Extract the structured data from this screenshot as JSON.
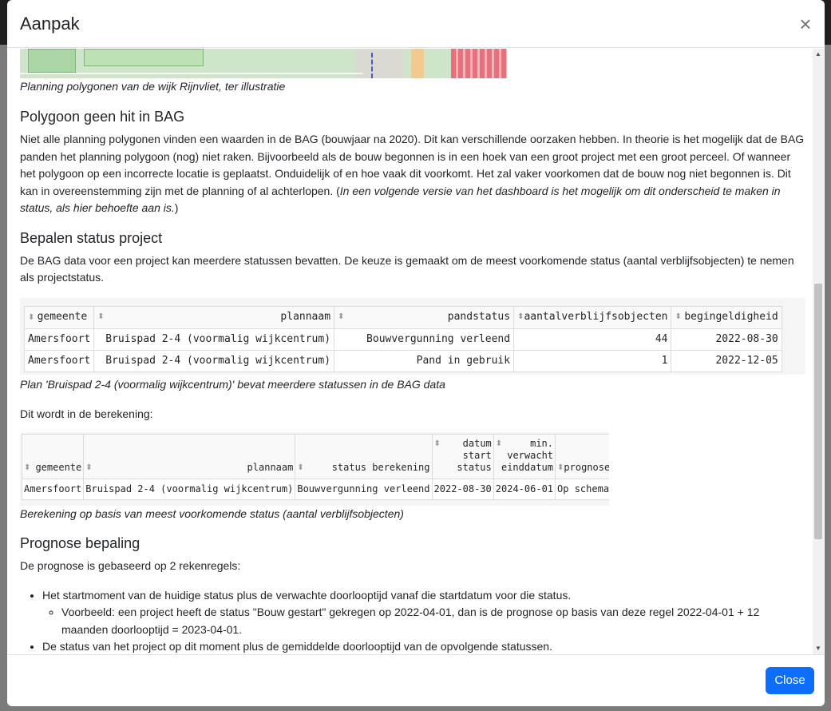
{
  "modal": {
    "title": "Aanpak",
    "close_icon": "close-icon",
    "close_label": "Close"
  },
  "map_caption": "Planning polygonen van de wijk Rijnvliet, ter illustratie",
  "section1": {
    "heading": "Polygoon geen hit in BAG",
    "text": "Niet alle planning polygonen vinden een waarden in de BAG (bouwjaar na 2020). Dit kan verschillende oorzaken hebben. In theorie is het mogelijk dat de BAG panden het planning polygoon (nog) niet raken. Bijvoorbeeld als de bouw begonnen is in een hoek van een groot project met een groot perceel. Of wanneer het polygoon op een incorrecte locatie is geplaatst. Onduidelijk of en hoe vaak dit voorkomt. Het zal vaker voorkomen dat de bouw nog niet begonnen is. Dit kan in overeenstemming zijn met de planning of al achterlopen. (",
    "italic": "In een volgende versie van het dashboard is het mogelijk om dit onderscheid te maken in status, als hier behoefte aan is.",
    "tail": ")"
  },
  "section2": {
    "heading": "Bepalen status project",
    "text": "De BAG data voor een project kan meerdere statussen bevatten. De keuze is gemaakt om de meest voorkomende status (aantal verblijfsobjecten) te nemen als projectstatus."
  },
  "table1": {
    "headers": [
      "gemeente",
      "plannaam",
      "pandstatus",
      "aantalverblijfsobjecten",
      "begingeldigheid"
    ],
    "rows": [
      [
        "Amersfoort",
        "Bruispad 2-4 (voormalig wijkcentrum)",
        "Bouwvergunning verleend",
        "44",
        "2022-08-30"
      ],
      [
        "Amersfoort",
        "Bruispad 2-4 (voormalig wijkcentrum)",
        "Pand in gebruik",
        "1",
        "2022-12-05"
      ]
    ],
    "caption": "Plan 'Bruispad 2-4 (voormalig wijkcentrum)' bevat meerdere statussen in de BAG data"
  },
  "intro2": "Dit wordt in de berekening:",
  "table2": {
    "headers": [
      "gemeente",
      "plannaam",
      "status berekening",
      "datum start status",
      "min. verwacht einddatum",
      "prognose"
    ],
    "header_lines": [
      [
        "gemeente"
      ],
      [
        "plannaam"
      ],
      [
        "status berekening"
      ],
      [
        "datum",
        "start",
        "status"
      ],
      [
        "min.",
        "verwacht",
        "einddatum"
      ],
      [
        "prognose"
      ]
    ],
    "rows": [
      [
        "Amersfoort",
        "Bruispad 2-4 (voormalig wijkcentrum)",
        "Bouwvergunning verleend",
        "2022-08-30",
        "2024-06-01",
        "Op schema"
      ]
    ],
    "caption": "Berekening op basis van meest voorkomende status (aantal verblijfsobjecten)"
  },
  "section3": {
    "heading": "Prognose bepaling",
    "text": "De prognose is gebaseerd op 2 rekenregels:",
    "bullets": [
      "Het startmoment van de huidige status plus de verwachte doorlooptijd vanaf die startdatum voor die status.",
      "De status van het project op dit moment plus de gemiddelde doorlooptijd van de opvolgende statussen."
    ],
    "sub_bullet": "Voorbeeld: een project heeft de status \"Bouw gestart\" gekregen op 2022-04-01, dan is de prognose op basis van deze regel 2022-04-01 + 12 maanden doorlooptijd = 2023-04-01."
  },
  "colors": {
    "primary": "#0d6efd",
    "backdrop": "#7b7b7b"
  }
}
